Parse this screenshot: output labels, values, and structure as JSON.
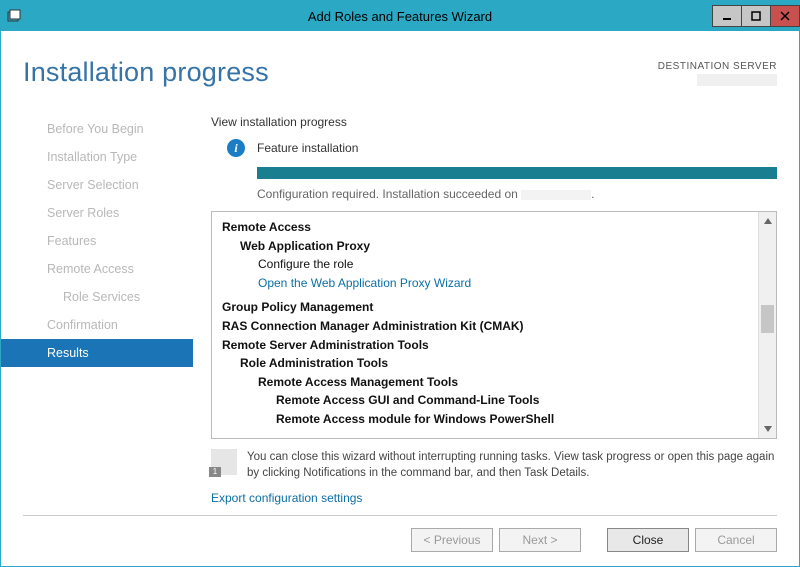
{
  "window": {
    "title": "Add Roles and Features Wizard"
  },
  "header": {
    "title": "Installation progress",
    "destination_label": "DESTINATION SERVER"
  },
  "sidebar": {
    "items": [
      {
        "label": "Before You Begin",
        "active": false
      },
      {
        "label": "Installation Type",
        "active": false
      },
      {
        "label": "Server Selection",
        "active": false
      },
      {
        "label": "Server Roles",
        "active": false
      },
      {
        "label": "Features",
        "active": false
      },
      {
        "label": "Remote Access",
        "active": false
      },
      {
        "label": "Role Services",
        "active": false,
        "sub": true
      },
      {
        "label": "Confirmation",
        "active": false
      },
      {
        "label": "Results",
        "active": true
      }
    ]
  },
  "content": {
    "view_label": "View installation progress",
    "status_title": "Feature installation",
    "status_message_pre": "Configuration required. Installation succeeded on ",
    "status_message_post": ".",
    "tree": {
      "root1": "Remote Access",
      "wap": "Web Application Proxy",
      "wap_sub": "Configure the role",
      "wap_link": "Open the Web Application Proxy Wizard",
      "gpm": "Group Policy Management",
      "cmak": "RAS Connection Manager Administration Kit (CMAK)",
      "rsat": "Remote Server Administration Tools",
      "rat": "Role Administration Tools",
      "ramt": "Remote Access Management Tools",
      "ragui": "Remote Access GUI and Command-Line Tools",
      "raps": "Remote Access module for Windows PowerShell"
    },
    "note": "You can close this wizard without interrupting running tasks. View task progress or open this page again by clicking Notifications in the command bar, and then Task Details.",
    "export_link": "Export configuration settings"
  },
  "footer": {
    "previous": "< Previous",
    "next": "Next >",
    "close": "Close",
    "cancel": "Cancel"
  }
}
